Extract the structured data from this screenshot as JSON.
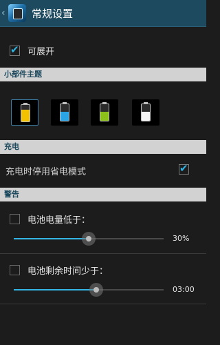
{
  "header": {
    "back_icon": "chevron-left-icon",
    "app_icon": "battery-app-icon",
    "title": "常规设置"
  },
  "general": {
    "expandable": {
      "label": "可展开",
      "checked": true
    }
  },
  "widget_theme": {
    "section_title": "小部件主题",
    "themes": [
      {
        "name": "battery-theme-yellow",
        "fill_color": "#f2c200",
        "selected": true
      },
      {
        "name": "battery-theme-blue",
        "fill_color": "#2aa4e3",
        "selected": false
      },
      {
        "name": "battery-theme-green",
        "fill_color": "#8cbf1a",
        "selected": false
      },
      {
        "name": "battery-theme-white",
        "fill_color": "#f5f5f5",
        "selected": false
      }
    ]
  },
  "charging": {
    "section_title": "充电",
    "disable_power_saving": {
      "label": "充电时停用省电模式",
      "checked": true
    }
  },
  "warning": {
    "section_title": "警告",
    "battery_low": {
      "label": "电池电量低于：",
      "checked": false,
      "value_text": "30%",
      "slider_level": 0.5
    },
    "time_remaining": {
      "label": "电池剩余时间少于：",
      "checked": false,
      "value_text": "03:00",
      "slider_level": 0.55
    }
  },
  "colors": {
    "title_bar": "#1d4a5e",
    "accent": "#33b5e5",
    "section_header_bg": "#d2d2d2",
    "section_header_text": "#1d4a5e",
    "background": "#1c1c1c"
  }
}
